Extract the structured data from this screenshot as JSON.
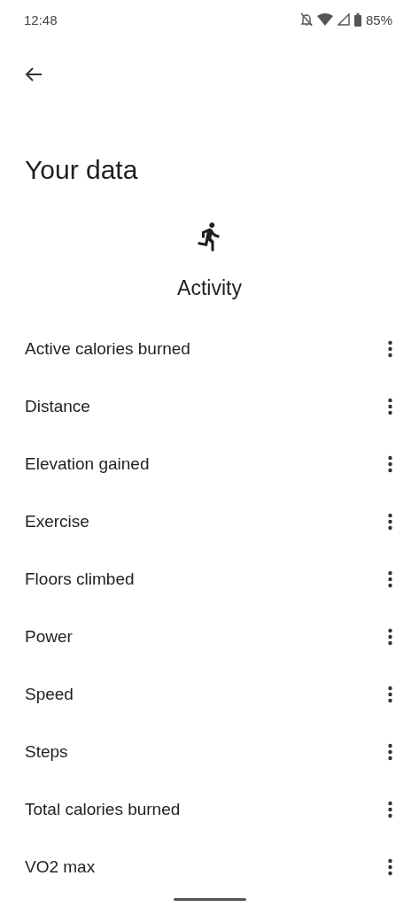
{
  "status_bar": {
    "time": "12:48",
    "battery": "85%"
  },
  "title": "Your data",
  "category": {
    "label": "Activity"
  },
  "items": [
    {
      "label": "Active calories burned"
    },
    {
      "label": "Distance"
    },
    {
      "label": "Elevation gained"
    },
    {
      "label": "Exercise"
    },
    {
      "label": "Floors climbed"
    },
    {
      "label": "Power"
    },
    {
      "label": "Speed"
    },
    {
      "label": "Steps"
    },
    {
      "label": "Total calories burned"
    },
    {
      "label": "VO2 max"
    }
  ]
}
